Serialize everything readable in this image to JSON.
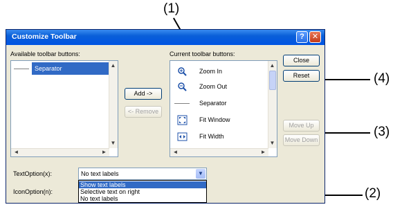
{
  "callouts": {
    "c1": "(1)",
    "c2": "(2)",
    "c3": "(3)",
    "c4": "(4)"
  },
  "dialog": {
    "title": "Customize Toolbar",
    "help_glyph": "?",
    "close_glyph": "✕",
    "available_label": "Available toolbar buttons:",
    "current_label": "Current toolbar buttons:",
    "available_items": [
      "Separator"
    ],
    "current_items": [
      {
        "label": "Zoom In",
        "icon": "zoom-in-icon"
      },
      {
        "label": "Zoom Out",
        "icon": "zoom-out-icon"
      },
      {
        "label": "Separator",
        "icon": "separator-line"
      },
      {
        "label": "Fit Window",
        "icon": "fit-window-icon"
      },
      {
        "label": "Fit Width",
        "icon": "fit-width-icon"
      }
    ],
    "buttons": {
      "add": "Add ->",
      "remove": "<- Remove",
      "close": "Close",
      "reset": "Reset",
      "move_up": "Move Up",
      "move_down": "Move Down"
    },
    "text_option_label": "TextOption(x):",
    "icon_option_label": "IconOption(n):",
    "text_option_value": "No text labels",
    "text_option_options": [
      "Show text labels",
      "Selective text on right",
      "No text labels"
    ]
  },
  "colors": {
    "title_bar": "#0054e3",
    "selection": "#316ac5",
    "dialog_bg": "#ece9d8"
  }
}
